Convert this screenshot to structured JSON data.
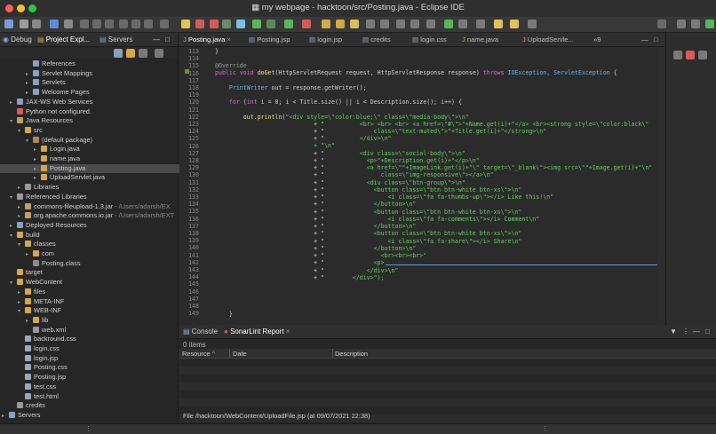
{
  "window": {
    "title": "my webpage - hacktoon/src/Posting.java - Eclipse IDE",
    "colors": {
      "close": "#ff5f57",
      "minimize": "#febc2e",
      "zoom": "#28c840"
    }
  },
  "left_panel": {
    "tabs": [
      "Debug",
      "Project Expl...",
      "Servers"
    ],
    "tree": [
      {
        "label": "References"
      },
      {
        "label": "Servlet Mappings"
      },
      {
        "label": "Servlets"
      },
      {
        "label": "Welcome Pages"
      },
      {
        "label": "JAX-WS Web Services"
      },
      {
        "label": "Python not configured."
      },
      {
        "label": "Java Resources"
      },
      {
        "label": "src"
      },
      {
        "label": "(default package)"
      },
      {
        "label": "Login.java"
      },
      {
        "label": "name.java"
      },
      {
        "label": "Posting.java"
      },
      {
        "label": "UploadServlet.java"
      },
      {
        "label": "Libraries"
      },
      {
        "label": "Referenced Libraries"
      },
      {
        "label": "commons-fileupload-1.3.jar",
        "extra": " - /Users/adarsh/EX"
      },
      {
        "label": "org.apache.commons.io.jar",
        "extra": " - /Users/adarsh/EXT"
      },
      {
        "label": "Deployed Resources"
      },
      {
        "label": "build"
      },
      {
        "label": "classes"
      },
      {
        "label": "com"
      },
      {
        "label": "Posting.class"
      },
      {
        "label": "target"
      },
      {
        "label": "WebContent"
      },
      {
        "label": "files"
      },
      {
        "label": "META-INF"
      },
      {
        "label": "WEB-INF"
      },
      {
        "label": "lib"
      },
      {
        "label": "web.xml"
      },
      {
        "label": "backround.css"
      },
      {
        "label": "login.css"
      },
      {
        "label": "login.jsp"
      },
      {
        "label": "Posting.css"
      },
      {
        "label": "Posting.jsp"
      },
      {
        "label": "test.css"
      },
      {
        "label": "test.html"
      },
      {
        "label": "credits"
      },
      {
        "label": "Servers"
      }
    ]
  },
  "editor": {
    "tabs": [
      "Posting.java",
      "Posting.jsp",
      "login.jsp",
      "credits",
      "login.css",
      "name.java",
      "UploadServle...",
      "»9"
    ],
    "line_numbers": [
      "113",
      "114",
      "115",
      "116",
      "117",
      "118",
      "119",
      "120",
      "121",
      "122",
      "123",
      "124",
      "125",
      "126",
      "127",
      "128",
      "129",
      "130",
      "131",
      "132",
      "133",
      "134",
      "135",
      "136",
      "137",
      "138",
      "139",
      "140",
      "141",
      "142",
      "143",
      "144",
      "145",
      "146",
      "147",
      "148",
      "149"
    ],
    "code": {
      "l113": "}",
      "l115": "@Override",
      "l116a": "public",
      "l116b": "void",
      "l116c": "doGet",
      "l116d": "(HttpServletRequest request, HttpServletResponse response)",
      "l116e": "throws",
      "l116f": "IOException, ServletException",
      "l116g": "{",
      "l118a": "PrintWriter",
      "l118b": " out = response.getWriter();",
      "l120a": "for",
      "l120b": " (",
      "l120c": "int",
      "l120d": " i = 0; i < Title.size() || i < Description.size(); i++) {",
      "l122a": "out.println(",
      "l122b": "\"<div style=\\\"color:blue;\\\" class=\\\"media-body\\\">\\n\"",
      "l123a": "+ \"",
      "l123b": "<br> <br> <br> <a href=\\\"#\\\">\"+Name.get(i)+\"</a> <br><strong style=\\\"color:black\\\"",
      "l124a": "+ \"",
      "l124b": "class=\\\"text-muted\\\">\"+Title.get(i)+\"</strong>\\n\"",
      "l125a": "+ \"",
      "l125b": "</div>\\n\"",
      "l126": "+ \"\\n\"",
      "l127a": "+ \"",
      "l127b": "<div class=\\\"social-body\\\">\\n\"",
      "l128a": "+ \"",
      "l128b": "<p>\"+Description.get(i)+\"</p>\\n\"",
      "l129a": "+ \"",
      "l129b": "<a href=\\\"\"+ImageLink.get(i)+\"\\\" target=\\\"_blank\\\"><img src=\\\"\"+Image.get(i)+\"\\n\"",
      "l130a": "+ \"",
      "l130b": "class=\\\"img-responsive\\\"></a>\\n\"",
      "l131a": "+ \"",
      "l131b": "<div class=\\\"btn-group\\\">\\n\"",
      "l132a": "+ \"",
      "l132b": "<button class=\\\"btn btn-white btn-xs\\\">\\n\"",
      "l133a": "+ \"",
      "l133b": "<i class=\\\"fa fa-thumbs-up\\\"></i> Like this!\\n\"",
      "l134a": "+ \"",
      "l134b": "</button>\\n\"",
      "l135a": "+ \"",
      "l135b": "<button class=\\\"btn btn-white btn-xs\\\">\\n\"",
      "l136a": "+ \"",
      "l136b": "<i class=\\\"fa fa-comments\\\"></i> Comment\\n\"",
      "l137a": "+ \"",
      "l137b": "</button>\\n\"",
      "l138a": "+ \"",
      "l138b": "<button class=\\\"btn btn-white btn-xs\\\">\\n\"",
      "l139a": "+ \"",
      "l139b": "<i class=\\\"fa fa-share\\\"></i> Share\\n\"",
      "l140a": "+ \"",
      "l140b": "</button>\\n\"",
      "l141a": "+ \"",
      "l141b": "<br><br><br>\"",
      "l142a": "+ \"",
      "l142b": "<p>",
      "l143a": "+ \"",
      "l143b": "</div>\\n\"",
      "l144a": "+ \"",
      "l144b": "</div>\");",
      "l149": "}"
    }
  },
  "console": {
    "tabs": [
      "Console",
      "SonarLint Report"
    ],
    "items_count": "0 items",
    "columns": [
      "Resource",
      "Date",
      "Description"
    ]
  },
  "status": {
    "path": "File /hacktoon/WebContent/UploadFile.jsp (at 09/07/2021 22:38)"
  }
}
